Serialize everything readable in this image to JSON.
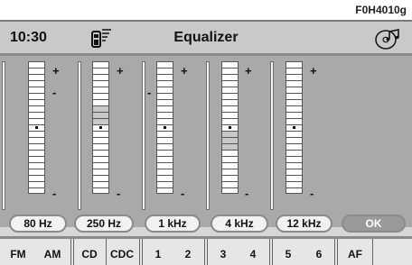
{
  "figure_code": "F0H4010g",
  "header": {
    "time": "10:30",
    "title": "Equalizer",
    "phone_icon": "phone-signal-icon",
    "music_icon": "music-cd-icon"
  },
  "equalizer": {
    "plus_label": "+",
    "minus_label": "-",
    "bands": [
      {
        "label": "80 Hz",
        "level": 0
      },
      {
        "label": "250 Hz",
        "level": 3
      },
      {
        "label": "1 kHz",
        "level": 0
      },
      {
        "label": "4 kHz",
        "level": -3
      },
      {
        "label": "12 kHz",
        "level": 0
      }
    ],
    "ok_label": "OK"
  },
  "sources": [
    "FM",
    "AM",
    "CD",
    "CDC",
    "1",
    "2",
    "3",
    "4",
    "5",
    "6",
    "AF"
  ]
}
